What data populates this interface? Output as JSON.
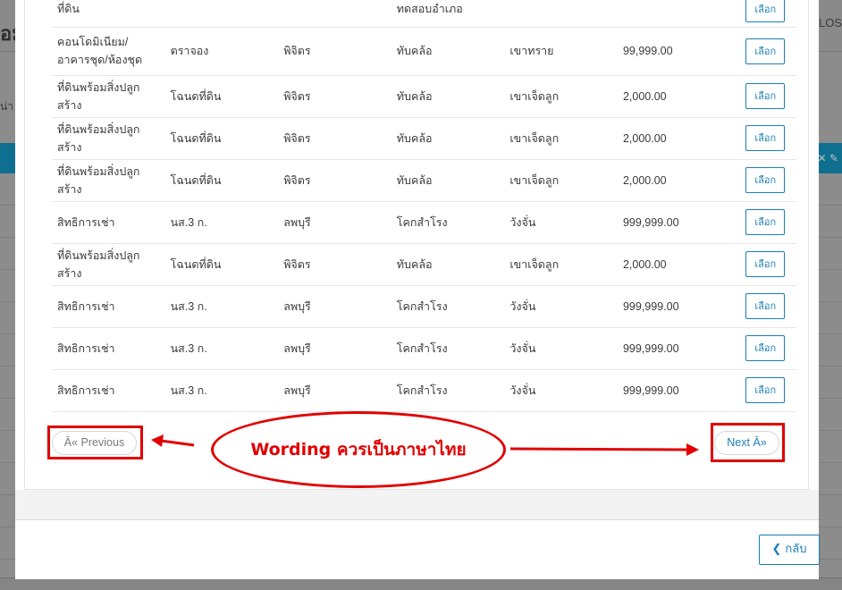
{
  "background": {
    "title_fragment": "อมู",
    "right_fragment": "LOS",
    "left_fragment": "น่า"
  },
  "rows": [
    {
      "type": "ที่ดิน",
      "doc": "",
      "province": "",
      "district": "ทดสอบอำเภอ",
      "subdistrict": "",
      "price": "",
      "action": "เลือก"
    },
    {
      "type": "คอนโดมิเนียม/อาคารชุด/ห้องชุด",
      "doc": "ตราจอง",
      "province": "พิจิตร",
      "district": "ทับคล้อ",
      "subdistrict": "เขาทราย",
      "price": "99,999.00",
      "action": "เลือก"
    },
    {
      "type": "ที่ดินพร้อมสิ่งปลูกสร้าง",
      "doc": "โฉนดที่ดิน",
      "province": "พิจิตร",
      "district": "ทับคล้อ",
      "subdistrict": "เขาเจ็ดลูก",
      "price": "2,000.00",
      "action": "เลือก"
    },
    {
      "type": "ที่ดินพร้อมสิ่งปลูกสร้าง",
      "doc": "โฉนดที่ดิน",
      "province": "พิจิตร",
      "district": "ทับคล้อ",
      "subdistrict": "เขาเจ็ดลูก",
      "price": "2,000.00",
      "action": "เลือก"
    },
    {
      "type": "ที่ดินพร้อมสิ่งปลูกสร้าง",
      "doc": "โฉนดที่ดิน",
      "province": "พิจิตร",
      "district": "ทับคล้อ",
      "subdistrict": "เขาเจ็ดลูก",
      "price": "2,000.00",
      "action": "เลือก"
    },
    {
      "type": "สิทธิการเช่า",
      "doc": "นส.3 ก.",
      "province": "ลพบุรี",
      "district": "โคกสำโรง",
      "subdistrict": "วังจั่น",
      "price": "999,999.00",
      "action": "เลือก"
    },
    {
      "type": "ที่ดินพร้อมสิ่งปลูกสร้าง",
      "doc": "โฉนดที่ดิน",
      "province": "พิจิตร",
      "district": "ทับคล้อ",
      "subdistrict": "เขาเจ็ดลูก",
      "price": "2,000.00",
      "action": "เลือก"
    },
    {
      "type": "สิทธิการเช่า",
      "doc": "นส.3 ก.",
      "province": "ลพบุรี",
      "district": "โคกสำโรง",
      "subdistrict": "วังจั่น",
      "price": "999,999.00",
      "action": "เลือก"
    },
    {
      "type": "สิทธิการเช่า",
      "doc": "นส.3 ก.",
      "province": "ลพบุรี",
      "district": "โคกสำโรง",
      "subdistrict": "วังจั่น",
      "price": "999,999.00",
      "action": "เลือก"
    },
    {
      "type": "สิทธิการเช่า",
      "doc": "นส.3 ก.",
      "province": "ลพบุรี",
      "district": "โคกสำโรง",
      "subdistrict": "วังจั่น",
      "price": "999,999.00",
      "action": "เลือก"
    }
  ],
  "pagination": {
    "previous_label": "Â« Previous",
    "next_label": "Next Â»"
  },
  "annotation": {
    "text": "Wording ควรเป็นภาษาไทย",
    "color": "#e10000"
  },
  "footer": {
    "back_label": "กลับ",
    "back_icon": "chevron-left-icon"
  },
  "colors": {
    "accent": "#1a7fb3",
    "header_band": "#0f6f90"
  }
}
